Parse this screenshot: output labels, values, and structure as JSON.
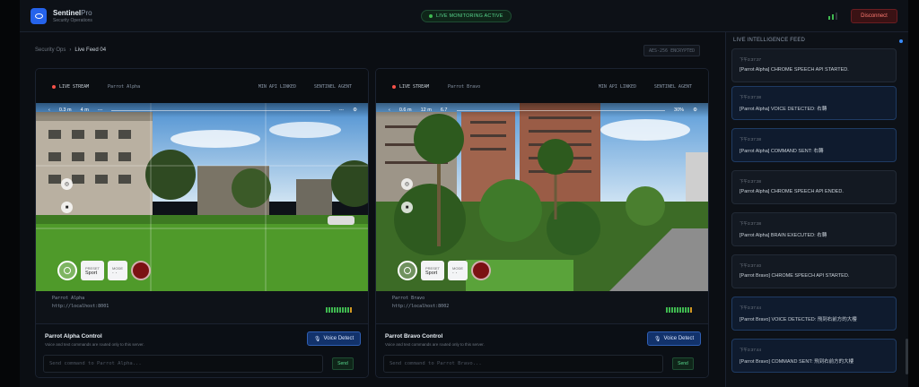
{
  "app": {
    "name": "Sentinel",
    "name_suffix": "Pro",
    "subtitle": "Security Operations"
  },
  "status": {
    "monitoring": "LIVE MONITORING ACTIVE"
  },
  "header": {
    "disconnect": "Disconnect"
  },
  "breadcrumb": {
    "root": "Security Ops",
    "current": "Live Feed 04"
  },
  "encryption_label": "AES-256 ENCRYPTED",
  "feeds": [
    {
      "live": "LIVE STREAM",
      "name": "Parrot Alpha",
      "tag1": "MIN API LINKED",
      "tag2": "SENTINEL AGENT",
      "hud": {
        "dist": "0.3 m",
        "alt": "4 m",
        "speed": "---",
        "battery": "---"
      },
      "controls": {
        "preset_label": "PRESET",
        "preset_value": "Sport",
        "mode_label": "MODE"
      },
      "meta_name": "Parrot Alpha",
      "meta_url": "http://localhost:8001",
      "ctrl_title": "Parrot Alpha Control",
      "ctrl_sub": "Voice and text commands are routed only to this server.",
      "voice": "Voice Detect",
      "placeholder": "Send command to Parrot Alpha...",
      "send": "Send"
    },
    {
      "live": "LIVE STREAM",
      "name": "Parrot Bravo",
      "tag1": "MIN API LINKED",
      "tag2": "SENTINEL AGENT",
      "hud": {
        "dist": "0.6 m",
        "alt": "12 m",
        "speed": "6.7",
        "battery": "30%"
      },
      "controls": {
        "preset_label": "PRESET",
        "preset_value": "Sport",
        "mode_label": "MODE"
      },
      "meta_name": "Parrot Bravo",
      "meta_url": "http://localhost:8002",
      "ctrl_title": "Parrot Bravo Control",
      "ctrl_sub": "Voice and text commands are routed only to this server.",
      "voice": "Voice Detect",
      "placeholder": "Send command to Parrot Bravo...",
      "send": "Send"
    }
  ],
  "intel": {
    "title": "LIVE INTELLIGENCE FEED",
    "entries": [
      {
        "time": "下午3:37:37",
        "msg": "[Parrot Alpha] CHROME SPEECH API STARTED."
      },
      {
        "time": "下午3:37:38",
        "msg": "[Parrot Alpha] VOICE DETECTED: 右轉"
      },
      {
        "time": "下午3:37:38",
        "msg": "[Parrot Alpha] COMMAND SENT: 右轉"
      },
      {
        "time": "下午3:37:38",
        "msg": "[Parrot Alpha] CHROME SPEECH API ENDED."
      },
      {
        "time": "下午3:37:38",
        "msg": "[Parrot Alpha] BRAIN EXECUTED: 右轉"
      },
      {
        "time": "下午3:37:40",
        "msg": "[Parrot Bravo] CHROME SPEECH API STARTED."
      },
      {
        "time": "下午3:37:44",
        "msg": "[Parrot Bravo] VOICE DETECTED: 飛到右前方的大樓"
      },
      {
        "time": "下午3:37:44",
        "msg": "[Parrot Bravo] COMMAND SENT: 飛到右前方的大樓"
      }
    ]
  }
}
